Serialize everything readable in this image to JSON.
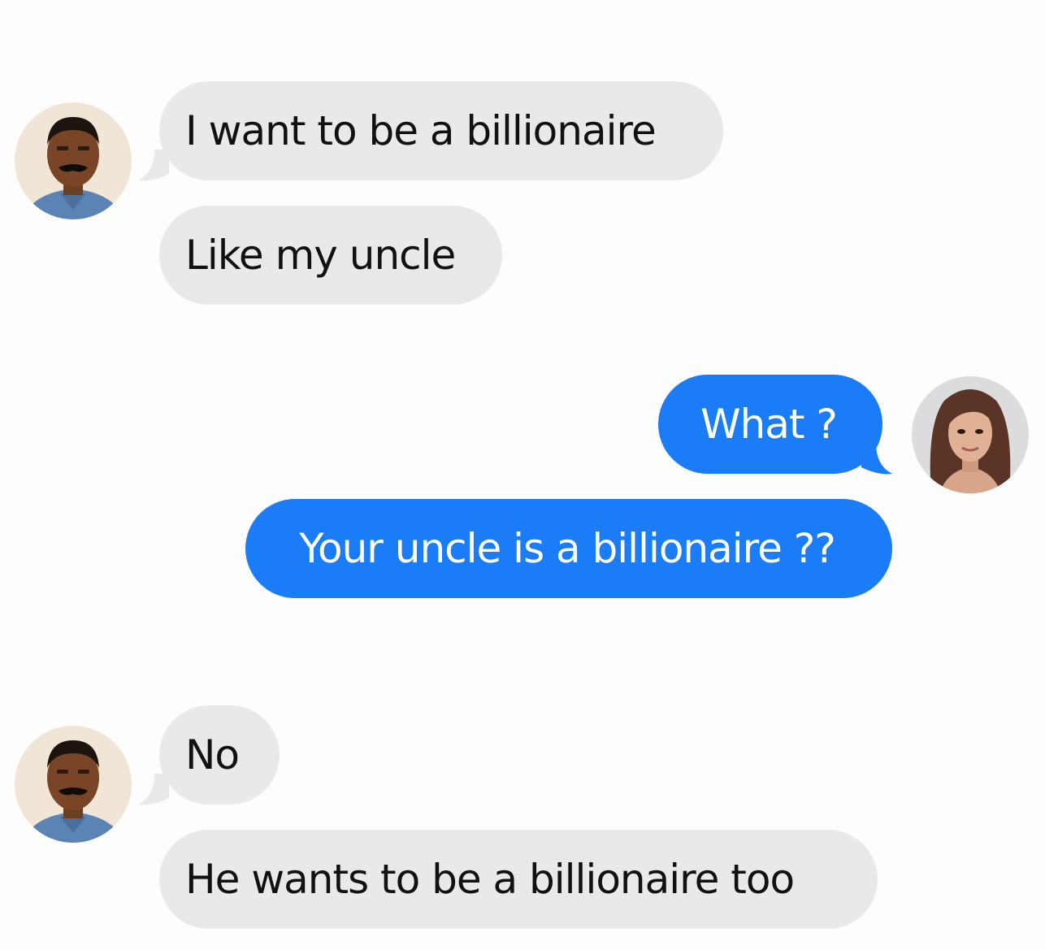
{
  "conversation": {
    "messages": [
      {
        "sender": "other",
        "text": "I want to be a billionaire"
      },
      {
        "sender": "other",
        "text": "Like my uncle"
      },
      {
        "sender": "self",
        "text": "What ?"
      },
      {
        "sender": "self",
        "text": "Your uncle is a billionaire ??"
      },
      {
        "sender": "other",
        "text": "No"
      },
      {
        "sender": "other",
        "text": "He wants to be a billionaire too"
      }
    ],
    "colors": {
      "received_bubble": "#e9e9eb",
      "sent_bubble": "#1b7cf7",
      "background": "#fdfdfe"
    },
    "avatars": {
      "other": "man-avatar",
      "self": "woman-avatar"
    }
  }
}
